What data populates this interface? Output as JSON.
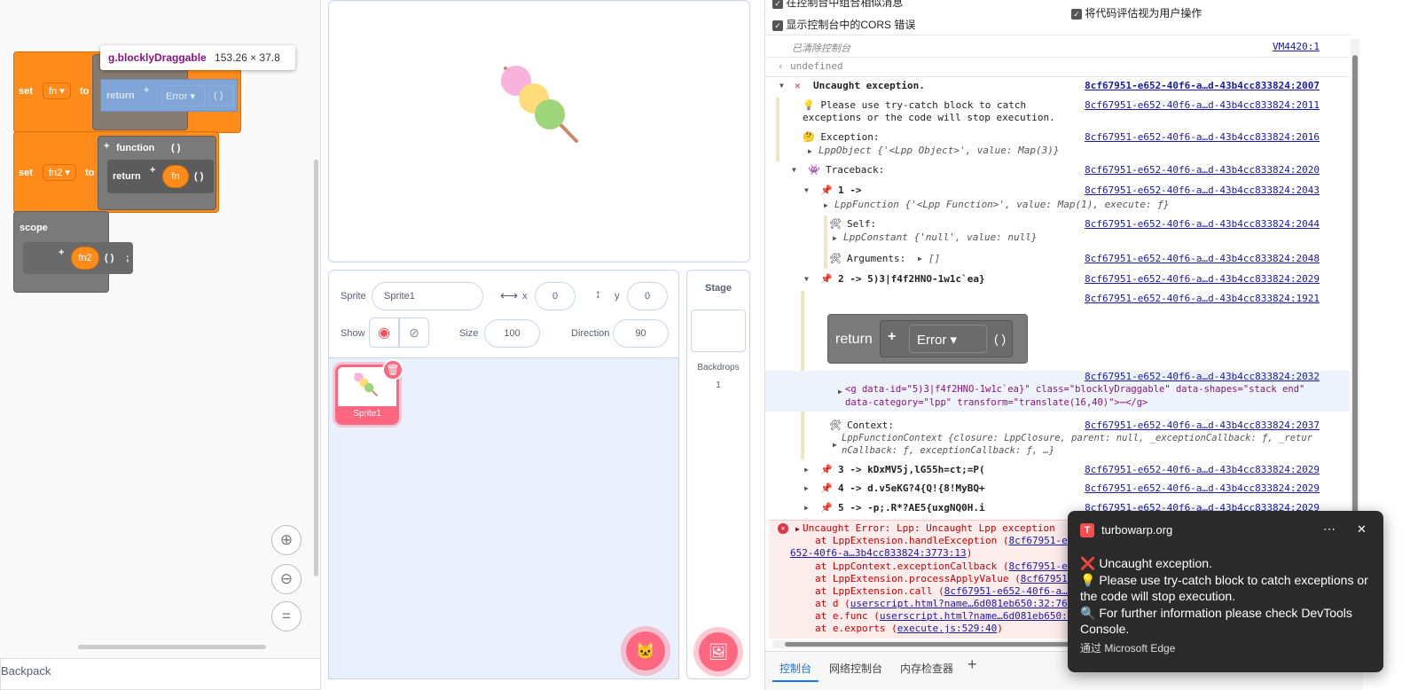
{
  "blocks": {
    "tooltip_name": "g.blocklyDraggable",
    "tooltip_size": "153.26 × 37.8",
    "set_label": "set",
    "to_label": "to",
    "var1": "fn",
    "var2": "fn2",
    "return_label": "return",
    "error_label": "Error",
    "parens": "( )",
    "function_label": "function",
    "fn_pill": "fn",
    "scope_label": "scope",
    "fn2_pill": "fn2",
    "semicolon": ";",
    "plus": "+"
  },
  "backpack_label": "Backpack",
  "sprite_info": {
    "sprite_label": "Sprite",
    "sprite_name": "Sprite1",
    "x_label": "x",
    "x_value": "0",
    "y_label": "y",
    "y_value": "0",
    "show_label": "Show",
    "size_label": "Size",
    "size_value": "100",
    "direction_label": "Direction",
    "direction_value": "90"
  },
  "sprite_tile_name": "Sprite1",
  "stage_panel": {
    "title": "Stage",
    "backdrops_label": "Backdrops",
    "backdrops_count": "1"
  },
  "devtools": {
    "setting_group": "在控制台中组合相似消息",
    "setting_cors": "显示控制台中的CORS 错误",
    "setting_eval": "将代码评估视为用户操作",
    "cleared": "已清除控制台",
    "cleared_src": "VM4420:1",
    "undefined": "undefined",
    "uncaught": "Uncaught exception.",
    "src_2007": "8cf67951-e652-40f6-a…d-43b4cc833824:2007",
    "please_line1": "💡 Please use try-catch block to catch",
    "please_line2": "exceptions or the code will stop execution.",
    "src_2011": "8cf67951-e652-40f6-a…d-43b4cc833824:2011",
    "exception_label": "🤔 Exception:",
    "src_2016": "8cf67951-e652-40f6-a…d-43b4cc833824:2016",
    "lpp_object": "LppObject {'<Lpp Object>', value: Map(3)}",
    "traceback_label": "Traceback:",
    "src_2020": "8cf67951-e652-40f6-a…d-43b4cc833824:2020",
    "tb1": "1 ->",
    "src_2043": "8cf67951-e652-40f6-a…d-43b4cc833824:2043",
    "lpp_function": "LppFunction {'<Lpp Function>', value: Map(1), execute: ƒ}",
    "self_label": "Self:",
    "src_2044": "8cf67951-e652-40f6-a…d-43b4cc833824:2044",
    "lpp_constant": "LppConstant {'null', value: null}",
    "args_label": "Arguments:",
    "args_value": "[]",
    "src_2048": "8cf67951-e652-40f6-a…d-43b4cc833824:2048",
    "tb2": "2 -> 5)3|f4f2HNO-1w1c`ea}",
    "src_2029": "8cf67951-e652-40f6-a…d-43b4cc833824:2029",
    "src_1921": "8cf67951-e652-40f6-a…d-43b4cc833824:1921",
    "preview_return": "return",
    "preview_plus": "+",
    "preview_error": "Error",
    "preview_parens": "( )",
    "src_2032": "8cf67951-e652-40f6-a…d-43b4cc833824:2032",
    "g_line1": "<g data-id=\"5)3|f4f2HNO-1w1c`ea}\" class=\"blocklyDraggable\" data-shapes=\"stack end\"",
    "g_line2": "data-category=\"lpp\" transform=\"translate(16,40)\">⋯</g>",
    "context_label": "Context:",
    "src_2037": "8cf67951-e652-40f6-a…d-43b4cc833824:2037",
    "ctx_line1": "LppFunctionContext {closure: LppClosure, parent: null, _exceptionCallback: ƒ, _retur",
    "ctx_line2": "nCallback: ƒ, exceptionCallback: ƒ, …}",
    "tb3": "3 -> kDxMV5j,lG55h=ct;=P(",
    "tb4": "4 -> d.v5eKG?4{Q!{8!MyBQ+",
    "tb5": "5 -> -p;.R*?AE5{uxgNQ0H.i",
    "err_title": "Uncaught Error: Lpp: Uncaught Lpp exception",
    "err1": "at LppExtension.handleException (",
    "err1_link": "8cf67951-e",
    "err1b_link": "652-40f6-a…3b4cc833824:3773:13",
    "err2": "at LppContext.exceptionCallback (",
    "err2_link": "8cf67951-e6",
    "err3": "at LppExtension.processApplyValue (",
    "err3_link": "8cf67951-",
    "err4": "at LppExtension.call (",
    "err4_link": "8cf67951-e652-40f6-a…3",
    "err5": "at d (",
    "err5_link": "userscript.html?name…6d081eb650:32:768",
    "err6": "at e.func (",
    "err6_link": "userscript.html?name…6d081eb650:3",
    "err7": "at e.exports (",
    "err7_link": "execute.js:529:40",
    "tabs": [
      "控制台",
      "网络控制台",
      "内存检查器"
    ],
    "tab_add": "+"
  },
  "toast": {
    "site": "turbowarp.org",
    "more": "⋯",
    "close": "✕",
    "line1": "❌ Uncaught exception.",
    "line2": "💡 Please use try-catch block to catch exceptions or the code will stop execution.",
    "line3": "🔍 For further information please check DevTools Console.",
    "via": "通过 Microsoft Edge"
  },
  "colors": {
    "block_orange": "#ff8c1a",
    "block_gray": "#7a7a7a",
    "scratch_pink": "#ff6680",
    "link_blue": "#1a1aa6",
    "error_bg": "#fdecec"
  }
}
